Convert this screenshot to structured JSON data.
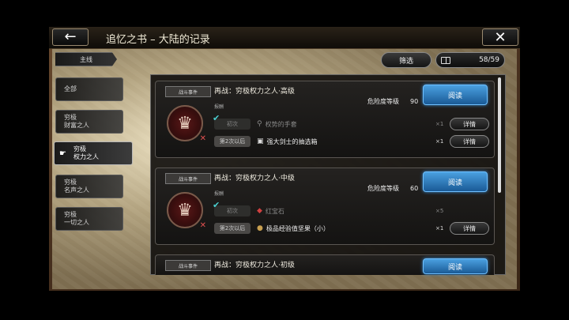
{
  "header": {
    "title": "追忆之书 – 大陆的记录",
    "back_symbol": "←",
    "close_symbol": "✕"
  },
  "main_tab": "主线",
  "filter_label": "筛选",
  "counter": "58/59",
  "sidebar": [
    {
      "l1": "全部",
      "l2": ""
    },
    {
      "l1": "穷极",
      "l2": "财富之人"
    },
    {
      "l1": "穷极",
      "l2": "权力之人"
    },
    {
      "l1": "穷极",
      "l2": "名声之人"
    },
    {
      "l1": "穷极",
      "l2": "一切之人"
    }
  ],
  "sidebar_active": 2,
  "cards": [
    {
      "tag": "战斗事件",
      "title": "再战：穷极权力之人·高级",
      "reward_label": "报酬",
      "danger_label": "危险度等级",
      "danger": "90",
      "read": "阅读",
      "rows": [
        {
          "lbl": "初次",
          "name": "权势的手套",
          "qty": "×1",
          "detail": "详情",
          "first": true
        },
        {
          "lbl": "第2次以后",
          "name": "强大剑士的抽选箱",
          "qty": "×1",
          "detail": "详情",
          "first": false
        }
      ]
    },
    {
      "tag": "战斗事件",
      "title": "再战：穷极权力之人·中级",
      "reward_label": "报酬",
      "danger_label": "危险度等级",
      "danger": "60",
      "read": "阅读",
      "rows": [
        {
          "lbl": "初次",
          "name": "红宝石",
          "qty": "×5",
          "detail": "",
          "first": true
        },
        {
          "lbl": "第2次以后",
          "name": "极品经验值坚果（小）",
          "qty": "×1",
          "detail": "详情",
          "first": false
        }
      ]
    },
    {
      "tag": "战斗事件",
      "title": "再战：穷极权力之人·初级",
      "read": "阅读"
    }
  ],
  "colors": {
    "read_button": "#2f7ec4",
    "check": "#4ad0d0"
  },
  "icons": {
    "back": "arrow-left-icon",
    "close": "close-icon",
    "counter": "book-icon",
    "active_pointer": "pointing-hand-icon"
  }
}
